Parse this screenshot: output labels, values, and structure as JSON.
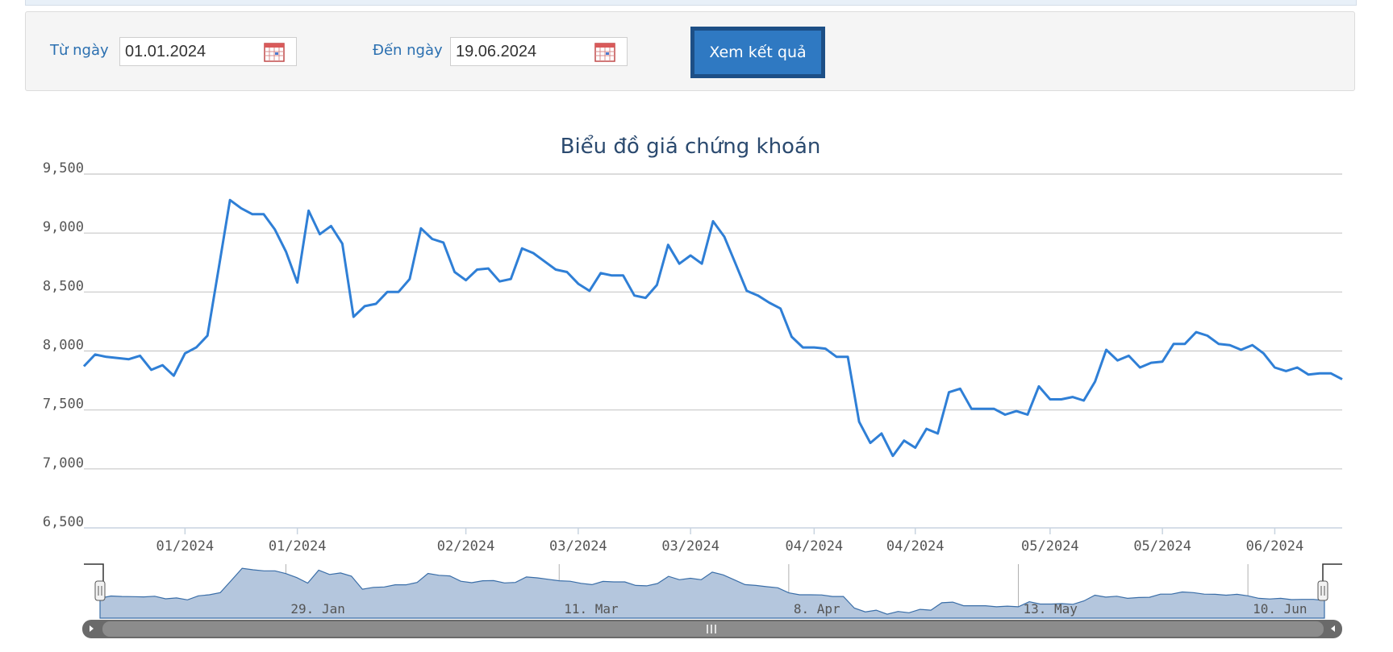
{
  "filter": {
    "from_label": "Từ ngày",
    "from_value": "01.01.2024",
    "to_label": "Đến ngày",
    "to_value": "19.06.2024",
    "submit_label": "Xem kết quả"
  },
  "colors": {
    "line": "#2f7fd6",
    "navigator_fill": "#b4c6dd",
    "navigator_line": "#3a6ea8",
    "grid": "#c8c8c8",
    "title": "#2b4a6f",
    "button": "#2f79c2",
    "label": "#2a6fb0"
  },
  "chart_data": {
    "type": "line",
    "title": "Biểu đồ giá chứng khoán",
    "xlabel": "",
    "ylabel": "",
    "ylim": [
      6500,
      9500
    ],
    "yticks": [
      9500,
      9000,
      8500,
      8000,
      7500,
      7000,
      6500
    ],
    "ytick_labels": [
      "9,500",
      "9,000",
      "8,500",
      "8,000",
      "7,500",
      "7,000",
      "6,500"
    ],
    "grid": true,
    "legend": "none",
    "xrange": [
      "2024-01-01",
      "2024-06-19"
    ],
    "xticks": [
      {
        "date": "2024-01-10",
        "label": "01/2024"
      },
      {
        "date": "2024-01-20",
        "label": "01/2024"
      },
      {
        "date": "2024-02-04",
        "label": "02/2024"
      },
      {
        "date": "2024-02-14",
        "label": "03/2024"
      },
      {
        "date": "2024-02-24",
        "label": "03/2024"
      },
      {
        "date": "2024-03-06",
        "label": "04/2024"
      },
      {
        "date": "2024-03-15",
        "label": "04/2024"
      },
      {
        "date": "2024-03-27",
        "label": "05/2024"
      },
      {
        "date": "2024-04-06",
        "label": "05/2024"
      },
      {
        "date": "2024-04-16",
        "label": "06/2024"
      }
    ],
    "series": [
      {
        "values": [
          [
            "2024-01-01",
            7870
          ],
          [
            "2024-01-02",
            7970
          ],
          [
            "2024-01-03",
            7950
          ],
          [
            "2024-01-04",
            7940
          ],
          [
            "2024-01-05",
            7930
          ],
          [
            "2024-01-06",
            7960
          ],
          [
            "2024-01-07",
            7840
          ],
          [
            "2024-01-08",
            7880
          ],
          [
            "2024-01-09",
            7790
          ],
          [
            "2024-01-10",
            7980
          ],
          [
            "2024-01-11",
            8030
          ],
          [
            "2024-01-12",
            8130
          ],
          [
            "2024-01-13",
            8700
          ],
          [
            "2024-01-14",
            9280
          ],
          [
            "2024-01-15",
            9210
          ],
          [
            "2024-01-16",
            9160
          ],
          [
            "2024-01-17",
            9160
          ],
          [
            "2024-01-18",
            9030
          ],
          [
            "2024-01-19",
            8840
          ],
          [
            "2024-01-20",
            8580
          ],
          [
            "2024-01-21",
            9190
          ],
          [
            "2024-01-22",
            8990
          ],
          [
            "2024-01-23",
            9060
          ],
          [
            "2024-01-24",
            8910
          ],
          [
            "2024-01-25",
            8290
          ],
          [
            "2024-01-26",
            8380
          ],
          [
            "2024-01-27",
            8400
          ],
          [
            "2024-01-28",
            8500
          ],
          [
            "2024-01-29",
            8500
          ],
          [
            "2024-01-30",
            8610
          ],
          [
            "2024-01-31",
            9040
          ],
          [
            "2024-02-01",
            8950
          ],
          [
            "2024-02-02",
            8920
          ],
          [
            "2024-02-03",
            8670
          ],
          [
            "2024-02-04",
            8600
          ],
          [
            "2024-02-05",
            8690
          ],
          [
            "2024-02-06",
            8700
          ],
          [
            "2024-02-07",
            8590
          ],
          [
            "2024-02-08",
            8610
          ],
          [
            "2024-02-09",
            8870
          ],
          [
            "2024-02-10",
            8830
          ],
          [
            "2024-02-11",
            8760
          ],
          [
            "2024-02-12",
            8690
          ],
          [
            "2024-02-13",
            8670
          ],
          [
            "2024-02-14",
            8570
          ],
          [
            "2024-02-15",
            8510
          ],
          [
            "2024-02-16",
            8660
          ],
          [
            "2024-02-17",
            8640
          ],
          [
            "2024-02-18",
            8640
          ],
          [
            "2024-02-19",
            8470
          ],
          [
            "2024-02-20",
            8450
          ],
          [
            "2024-02-21",
            8560
          ],
          [
            "2024-02-22",
            8900
          ],
          [
            "2024-02-23",
            8740
          ],
          [
            "2024-02-24",
            8810
          ],
          [
            "2024-02-25",
            8740
          ],
          [
            "2024-02-26",
            9100
          ],
          [
            "2024-02-27",
            8970
          ],
          [
            "2024-02-28",
            8740
          ],
          [
            "2024-02-29",
            8510
          ],
          [
            "2024-03-01",
            8470
          ],
          [
            "2024-03-02",
            8410
          ],
          [
            "2024-03-03",
            8360
          ],
          [
            "2024-03-04",
            8120
          ],
          [
            "2024-03-05",
            8030
          ],
          [
            "2024-03-06",
            8030
          ],
          [
            "2024-03-07",
            8020
          ],
          [
            "2024-03-08",
            7950
          ],
          [
            "2024-03-09",
            7950
          ],
          [
            "2024-03-10",
            7400
          ],
          [
            "2024-03-11",
            7220
          ],
          [
            "2024-03-12",
            7300
          ],
          [
            "2024-03-13",
            7110
          ],
          [
            "2024-03-14",
            7240
          ],
          [
            "2024-03-15",
            7180
          ],
          [
            "2024-03-16",
            7340
          ],
          [
            "2024-03-17",
            7300
          ],
          [
            "2024-03-18",
            7650
          ],
          [
            "2024-03-19",
            7680
          ],
          [
            "2024-03-20",
            7510
          ],
          [
            "2024-03-21",
            7510
          ],
          [
            "2024-03-22",
            7510
          ],
          [
            "2024-03-23",
            7460
          ],
          [
            "2024-03-24",
            7490
          ],
          [
            "2024-03-25",
            7460
          ],
          [
            "2024-03-26",
            7700
          ],
          [
            "2024-03-27",
            7590
          ],
          [
            "2024-03-28",
            7590
          ],
          [
            "2024-03-29",
            7610
          ],
          [
            "2024-03-30",
            7580
          ],
          [
            "2024-03-31",
            7740
          ],
          [
            "2024-04-01",
            8010
          ],
          [
            "2024-04-02",
            7920
          ],
          [
            "2024-04-03",
            7960
          ],
          [
            "2024-04-04",
            7860
          ],
          [
            "2024-04-05",
            7900
          ],
          [
            "2024-04-06",
            7910
          ],
          [
            "2024-04-07",
            8060
          ],
          [
            "2024-04-08",
            8060
          ],
          [
            "2024-04-09",
            8160
          ],
          [
            "2024-04-10",
            8130
          ],
          [
            "2024-04-11",
            8060
          ],
          [
            "2024-04-12",
            8050
          ],
          [
            "2024-04-13",
            8010
          ],
          [
            "2024-04-14",
            8050
          ],
          [
            "2024-04-15",
            7980
          ],
          [
            "2024-04-16",
            7860
          ],
          [
            "2024-04-17",
            7830
          ],
          [
            "2024-04-18",
            7860
          ],
          [
            "2024-04-19",
            7800
          ],
          [
            "2024-04-20",
            7810
          ],
          [
            "2024-04-21",
            7810
          ],
          [
            "2024-04-22",
            7760
          ]
        ]
      }
    ],
    "navigator": {
      "labels": [
        {
          "date": "2024-01-18",
          "label": "29. Jan"
        },
        {
          "date": "2024-02-12",
          "label": "11. Mar"
        },
        {
          "date": "2024-03-04",
          "label": "8. Apr"
        },
        {
          "date": "2024-03-25",
          "label": "13. May"
        },
        {
          "date": "2024-04-15",
          "label": "10. Jun"
        }
      ]
    }
  }
}
